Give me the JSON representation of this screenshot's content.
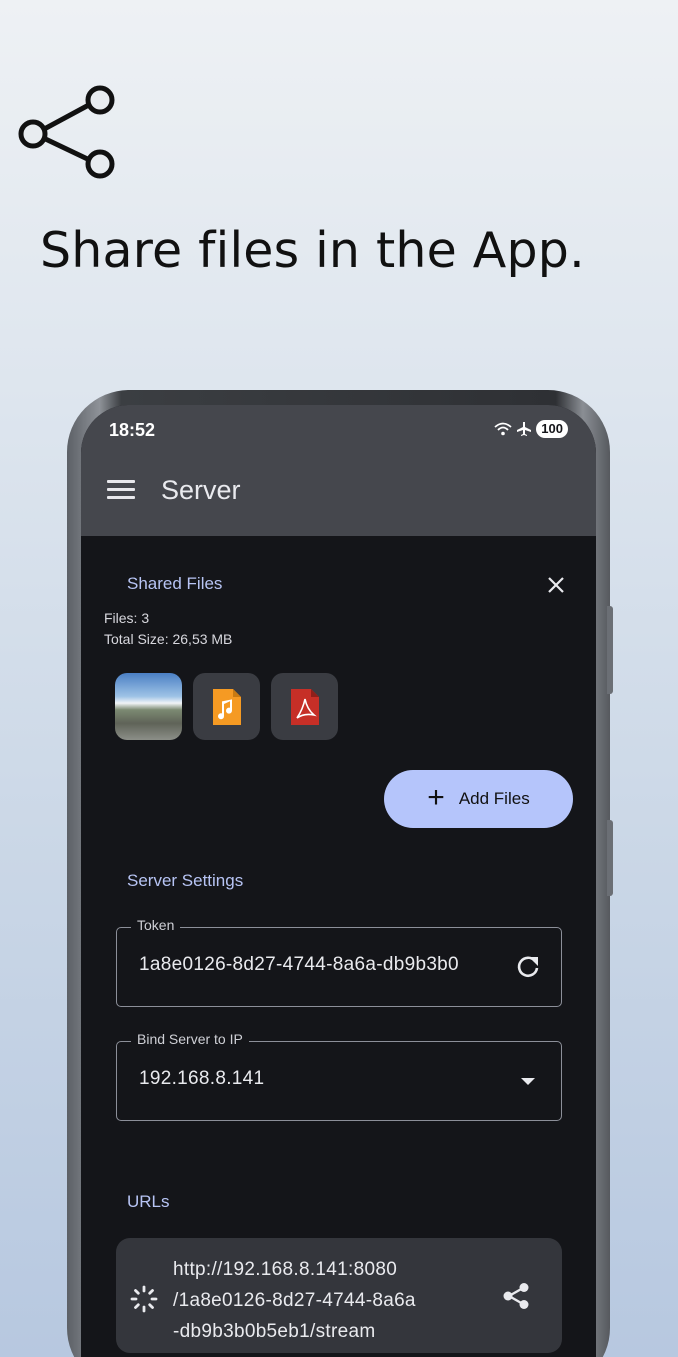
{
  "promo": {
    "icon": "share-icon",
    "headline": "Share files in the App."
  },
  "status_bar": {
    "time": "18:52",
    "battery": "100"
  },
  "app_bar": {
    "title": "Server",
    "menu_icon": "hamburger-menu-icon"
  },
  "shared_files": {
    "title": "Shared Files",
    "files_count": "Files: 3",
    "total_size": "Total Size: 26,53 MB",
    "thumbnails": [
      {
        "type": "image",
        "icon": "photo-thumbnail"
      },
      {
        "type": "audio",
        "icon": "music-file-icon",
        "color": "#f59a23"
      },
      {
        "type": "pdf",
        "icon": "pdf-file-icon",
        "color": "#c62f27"
      }
    ],
    "add_button": "Add Files"
  },
  "server_settings": {
    "title": "Server Settings",
    "token": {
      "label": "Token",
      "value": "1a8e0126-8d27-4744-8a6a-db9b3b0"
    },
    "bind_ip": {
      "label": "Bind Server to IP",
      "value": "192.168.8.141"
    }
  },
  "urls": {
    "title": "URLs",
    "items": [
      {
        "line1": "http://192.168.8.141:8080",
        "line2": "/1a8e0126-8d27-4744-8a6a",
        "line3": "-db9b3b0b5eb1/stream"
      }
    ]
  },
  "colors": {
    "accent": "#b5c5fb",
    "section_title": "#b7c4f4",
    "app_bar": "#45474d",
    "screen_bg": "#141519"
  }
}
